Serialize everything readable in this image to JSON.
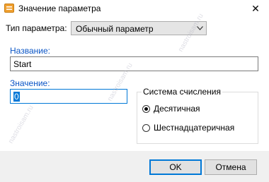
{
  "window": {
    "title": "Значение параметра",
    "close_glyph": "✕"
  },
  "form": {
    "type_label": "Тип параметра:",
    "type_value": "Обычный параметр",
    "name_label": "Название:",
    "name_value": "Start",
    "value_label": "Значение:",
    "value_value": "0"
  },
  "base_group": {
    "title": "Система счисления",
    "options": [
      {
        "label": "Десятичная",
        "selected": true
      },
      {
        "label": "Шестнадцатеричная",
        "selected": false
      }
    ]
  },
  "buttons": {
    "ok": "OK",
    "cancel": "Отмена"
  },
  "watermark": "nastroisam.ru",
  "colors": {
    "accent": "#0078d7",
    "label_blue": "#0a55c6",
    "icon_orange": "#f0a030"
  }
}
